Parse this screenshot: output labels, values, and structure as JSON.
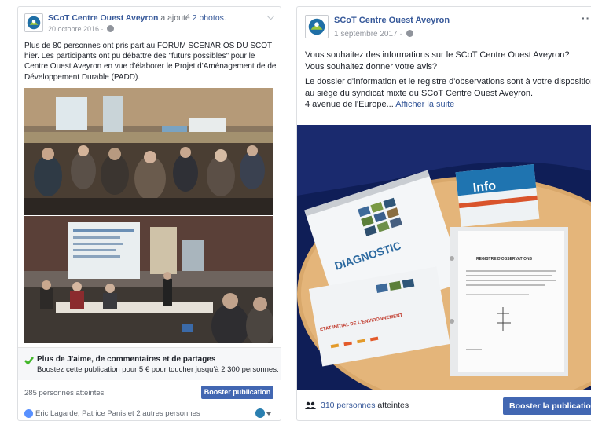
{
  "left_post": {
    "page_name": "SCoT Centre Ouest Aveyron",
    "action_text": " a ajouté ",
    "action_link": "2 photos",
    "action_end": ".",
    "date": "20 octobre 2016 · ",
    "body": "Plus de 80 personnes ont pris part au FORUM SCENARIOS DU SCOT hier. Les participants ont pu débattre des \"futurs possibles\" pour le Centre Ouest Aveyron en vue d'élaborer le Projet d'Aménagement de de Développement Durable (PADD).",
    "boost_title": "Plus de J'aime, de commentaires et de partages",
    "boost_desc": "Boostez cette publication pour 5 € pour toucher jusqu'à 2 300 personnes.",
    "reach": "285 personnes atteintes",
    "boost_button": "Booster publication",
    "reactions": "Eric Lagarde, Patrice Panis et 2 autres personnes"
  },
  "right_post": {
    "page_name": "SCoT Centre Ouest Aveyron",
    "date": "1 septembre 2017 · ",
    "line1": "Vous souhaitez des informations sur le SCoT Centre Ouest Aveyron?",
    "line2": "Vous souhaitez donner votre avis?",
    "line3": "Le dossier d'information et le registre d'observations sont à votre disposition au siège du syndicat mixte du SCoT Centre Ouest Aveyron.",
    "line4": "4 avenue de l'Europe... ",
    "see_more": "Afficher la suite",
    "reach_count": "310 personnes",
    "reach_suffix": " atteintes",
    "boost_button": "Booster la publication",
    "photo_text": {
      "diagnostic": "DIAGNOSTIC",
      "etat": "ETAT INITIAL DE L'ENVIRONNEMENT",
      "info": "Info",
      "registre": "REGISTRE D'OBSERVATIONS"
    }
  },
  "colors": {
    "link": "#365899",
    "button": "#4267b2",
    "check": "#42b72a",
    "muted": "#90949c"
  },
  "icons": [
    "globe-icon",
    "check-icon",
    "like-icon",
    "people-icon",
    "chevron-down-icon",
    "more-icon"
  ]
}
